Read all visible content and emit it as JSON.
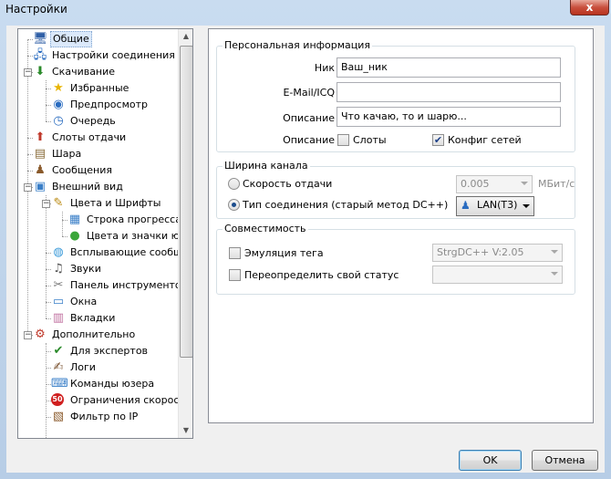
{
  "window": {
    "title": "Настройки",
    "close_glyph": "x"
  },
  "tree": {
    "items": [
      {
        "label": "Общие",
        "icon": "monitor-icon",
        "glyph": "🖥",
        "color": "#2f5fa6",
        "selected": true
      },
      {
        "label": "Настройки соединения",
        "icon": "network-icon",
        "glyph": "🖧",
        "color": "#2a6cc0"
      },
      {
        "label": "Скачивание",
        "icon": "download-icon",
        "glyph": "⬇",
        "color": "#2a8a2a"
      },
      {
        "label": "Избранные",
        "icon": "star-icon",
        "glyph": "★",
        "color": "#e8b400"
      },
      {
        "label": "Предпросмотр",
        "icon": "preview-icon",
        "glyph": "◉",
        "color": "#2a6cc0"
      },
      {
        "label": "Очередь",
        "icon": "queue-icon",
        "glyph": "◷",
        "color": "#2a6cc0"
      },
      {
        "label": "Слоты отдачи",
        "icon": "upload-slots-icon",
        "glyph": "⬆",
        "color": "#c0392b"
      },
      {
        "label": "Шара",
        "icon": "share-icon",
        "glyph": "▤",
        "color": "#8a6d3b"
      },
      {
        "label": "Сообщения",
        "icon": "messages-icon",
        "glyph": "♟",
        "color": "#8a5a2b"
      },
      {
        "label": "Внешний вид",
        "icon": "appearance-icon",
        "glyph": "▣",
        "color": "#3a7fc8"
      },
      {
        "label": "Цвета и Шрифты",
        "icon": "palette-icon",
        "glyph": "✎",
        "color": "#b8860b"
      },
      {
        "label": "Строка прогресса",
        "icon": "progress-bar-icon",
        "glyph": "▦",
        "color": "#3a7fc8"
      },
      {
        "label": "Цвета и значки юзеров",
        "icon": "user-colors-icon",
        "glyph": "●",
        "color": "#3aa63a"
      },
      {
        "label": "Всплывающие сообщения",
        "icon": "popup-icon",
        "glyph": "◍",
        "color": "#3a9ad9"
      },
      {
        "label": "Звуки",
        "icon": "sound-icon",
        "glyph": "♫",
        "color": "#555555"
      },
      {
        "label": "Панель инструментов",
        "icon": "toolbar-icon",
        "glyph": "✂",
        "color": "#777777"
      },
      {
        "label": "Окна",
        "icon": "windows-icon",
        "glyph": "▭",
        "color": "#3a7fc8"
      },
      {
        "label": "Вкладки",
        "icon": "tabs-icon",
        "glyph": "▥",
        "color": "#c070a0"
      },
      {
        "label": "Дополнительно",
        "icon": "advanced-icon",
        "glyph": "⚙",
        "color": "#c0392b"
      },
      {
        "label": "Для экспертов",
        "icon": "expert-shield-icon",
        "glyph": "✔",
        "color": "#2a8a2a"
      },
      {
        "label": "Логи",
        "icon": "logs-icon",
        "glyph": "✍",
        "color": "#7a5230"
      },
      {
        "label": "Команды юзера",
        "icon": "user-commands-icon",
        "glyph": "⌨",
        "color": "#3a7fc8"
      },
      {
        "label": "Ограничения скорости",
        "icon": "speed-limit-icon",
        "glyph": "50",
        "color": "#d02020"
      },
      {
        "label": "Фильтр по IP",
        "icon": "ip-filter-icon",
        "glyph": "▧",
        "color": "#8a5a2b"
      }
    ]
  },
  "personal": {
    "legend": "Персональная информация",
    "nick_label": "Ник",
    "nick_value": "Ваш_ник",
    "email_label": "E-Mail/ICQ",
    "email_value": "",
    "desc_label": "Описание",
    "desc_value": "Что качаю, то и шарю...",
    "desc2_label": "Описание",
    "slots_label": "Слоты",
    "slots_checked": false,
    "netconf_label": "Конфиг сетей",
    "netconf_checked": true,
    "check_glyph": "✔"
  },
  "bandwidth": {
    "legend": "Ширина канала",
    "upload_label": "Скорость отдачи",
    "upload_value": "0.005",
    "unit": "МБит/с",
    "conn_label": "Тип соединения (старый метод DC++)",
    "conn_value": "LAN(T3)",
    "selected": "conn"
  },
  "compat": {
    "legend": "Совместимость",
    "emul_label": "Эмуляция тега",
    "emul_value": "StrgDC++ V:2.05",
    "override_label": "Переопределить свой статус",
    "override_value": ""
  },
  "buttons": {
    "ok": "OK",
    "cancel": "Отмена"
  }
}
